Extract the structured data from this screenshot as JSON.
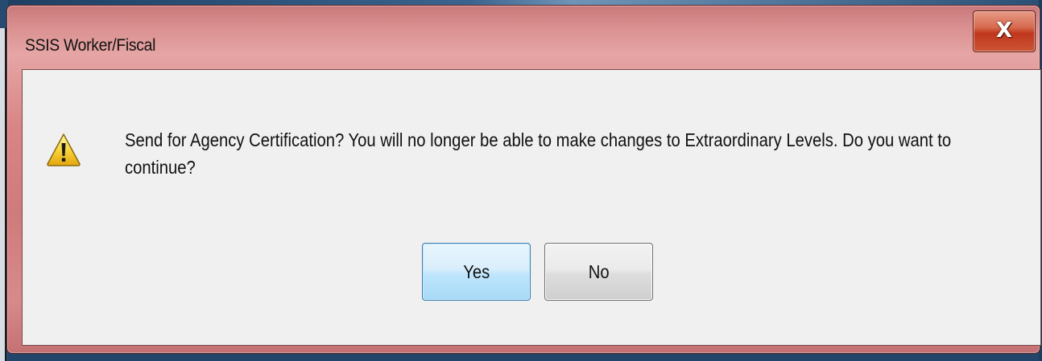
{
  "dialog": {
    "title": "SSIS Worker/Fiscal",
    "close_label": "X",
    "icon": "warning-icon",
    "message": "Send for Agency Certification?  You will no longer be able to make changes to Extraordinary Levels.  Do you want to continue?",
    "buttons": {
      "yes": "Yes",
      "no": "No"
    }
  },
  "colors": {
    "titlebar": "#d98585",
    "close_button": "#c0361c",
    "client_background": "#f0f0f0",
    "default_button": "#bee6fd"
  }
}
